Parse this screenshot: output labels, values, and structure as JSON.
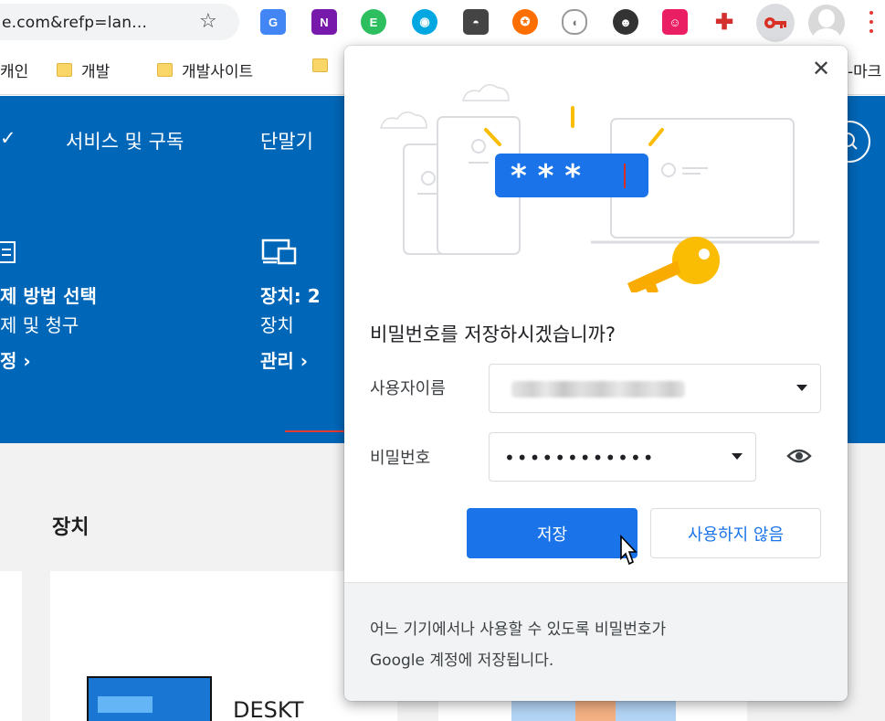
{
  "browser": {
    "omnibox_text": "e.com&refp=lan...",
    "star_icon": "star-icon",
    "extensions": [
      {
        "name": "google-translate-icon",
        "glyph": "G",
        "color": "#4285f4"
      },
      {
        "name": "onenote-icon",
        "glyph": "N",
        "color": "#7719aa"
      },
      {
        "name": "evernote-icon",
        "glyph": "E",
        "color": "#2dbe60"
      },
      {
        "name": "eye-extension-icon",
        "glyph": "◉",
        "color": "#00a7e1"
      },
      {
        "name": "lightbulb-extension-icon",
        "glyph": "◓",
        "color": "#444444"
      },
      {
        "name": "lifebuoy-extension-icon",
        "glyph": "✪",
        "color": "#ff6f00"
      },
      {
        "name": "mouse-extension-icon",
        "glyph": "◖",
        "color": "#9e9e9e"
      },
      {
        "name": "owl-extension-icon",
        "glyph": "☻",
        "color": "#333333"
      },
      {
        "name": "avatar-extension-icon",
        "glyph": "☺",
        "color": "#e91e63"
      },
      {
        "name": "puzzle-extension-icon",
        "glyph": "✚",
        "color": "#d32f2f"
      }
    ],
    "key_icon": "key-icon",
    "menu_icon": "menu-dots-icon"
  },
  "bookmarks": {
    "items": [
      {
        "label": "캐인"
      },
      {
        "label": "개발"
      },
      {
        "label": "개발사이트"
      },
      {
        "label": ""
      },
      {
        "label": "-마크"
      }
    ]
  },
  "page": {
    "nav": [
      "서비스 및 구독",
      "단말기"
    ],
    "billing": {
      "line1": "제 방법 선택",
      "line2": "제 및 청구",
      "link": "정 ›"
    },
    "devices_summary": {
      "line1": "장치: 2",
      "line2": "장치",
      "link": "관리 ›"
    },
    "devices_title": "장치",
    "device_name": "DESKT"
  },
  "popup": {
    "title": "비밀번호를 저장하시겠습니까?",
    "username_label": "사용자이름",
    "password_label": "비밀번호",
    "password_value": "••••••••••••",
    "save_label": "저장",
    "never_label": "사용하지 않음",
    "footer_line1": "어느 기기에서나 사용할 수 있도록 비밀번호가",
    "footer_line2": "Google 계정에 저장됩니다.",
    "illustration_masked": "* * *",
    "close_glyph": "✕"
  },
  "colors": {
    "accent": "#1a73e8",
    "hero_blue": "#0067b8",
    "annotation_arrow": "#e53935",
    "key_gold": "#fbbc04"
  }
}
